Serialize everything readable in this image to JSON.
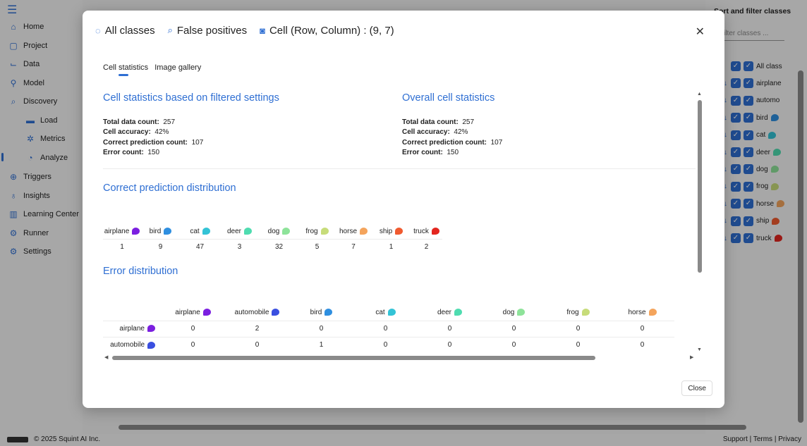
{
  "sidebar": {
    "items": [
      {
        "label": "Home",
        "icon": "home-icon",
        "glyph": "⌂"
      },
      {
        "label": "Project",
        "icon": "project-icon",
        "glyph": "▢"
      },
      {
        "label": "Data",
        "icon": "data-icon",
        "glyph": "⌙"
      },
      {
        "label": "Model",
        "icon": "model-icon",
        "glyph": "⚲"
      },
      {
        "label": "Discovery",
        "icon": "discovery-icon",
        "glyph": "⌕"
      },
      {
        "label": "Load",
        "icon": "folder-icon",
        "glyph": "▬"
      },
      {
        "label": "Metrics",
        "icon": "metrics-icon",
        "glyph": "✲"
      },
      {
        "label": "Analyze",
        "icon": "analyze-icon",
        "glyph": "◔"
      },
      {
        "label": "Triggers",
        "icon": "triggers-icon",
        "glyph": "⊕"
      },
      {
        "label": "Insights",
        "icon": "insights-icon",
        "glyph": "♁"
      },
      {
        "label": "Learning Center",
        "icon": "learning-center-icon",
        "glyph": "▥"
      },
      {
        "label": "Runner",
        "icon": "runner-icon",
        "glyph": "⚙"
      },
      {
        "label": "Settings",
        "icon": "settings-icon",
        "glyph": "⚙"
      }
    ]
  },
  "right_panel": {
    "title": "Sort and filter classes",
    "filter_placeholder": "Filter classes ...",
    "rows": [
      {
        "label": "All class",
        "color": ""
      },
      {
        "label": "airplane",
        "color": ""
      },
      {
        "label": "automo",
        "color": ""
      },
      {
        "label": "bird",
        "color": "#2f8fe0"
      },
      {
        "label": "cat",
        "color": "#33c3d6"
      },
      {
        "label": "deer",
        "color": "#4fdcb0"
      },
      {
        "label": "dog",
        "color": "#8ee39a"
      },
      {
        "label": "frog",
        "color": "#c7dc7a"
      },
      {
        "label": "horse",
        "color": "#f4a45c"
      },
      {
        "label": "ship",
        "color": "#f05a2f"
      },
      {
        "label": "truck",
        "color": "#e3261f"
      }
    ]
  },
  "footer": {
    "copyright": "© 2025 Squint AI Inc.",
    "links": "Support | Terms | Privacy"
  },
  "modal": {
    "header": {
      "all_classes": "All classes",
      "false_positives": "False positives",
      "cell": "Cell (Row, Column) : (9, 7)"
    },
    "tabs": [
      "Cell statistics",
      "Image gallery"
    ],
    "filtered": {
      "title": "Cell statistics based on filtered settings",
      "total_label": "Total data count:",
      "total": "257",
      "accuracy_label": "Cell accuracy:",
      "accuracy": "42%",
      "correct_label": "Correct prediction count:",
      "correct": "107",
      "error_label": "Error count:",
      "error": "150"
    },
    "overall": {
      "title": "Overall cell statistics",
      "total_label": "Total data count:",
      "total": "257",
      "accuracy_label": "Cell accuracy:",
      "accuracy": "42%",
      "correct_label": "Correct prediction count:",
      "correct": "107",
      "error_label": "Error count:",
      "error": "150"
    },
    "correct_dist": {
      "title": "Correct prediction distribution",
      "classes": [
        {
          "name": "airplane",
          "color": "#7b1fe0",
          "value": "1"
        },
        {
          "name": "bird",
          "color": "#2f8fe0",
          "value": "9"
        },
        {
          "name": "cat",
          "color": "#33c3d6",
          "value": "47"
        },
        {
          "name": "deer",
          "color": "#4fdcb0",
          "value": "3"
        },
        {
          "name": "dog",
          "color": "#8ee39a",
          "value": "32"
        },
        {
          "name": "frog",
          "color": "#c7dc7a",
          "value": "5"
        },
        {
          "name": "horse",
          "color": "#f4a45c",
          "value": "7"
        },
        {
          "name": "ship",
          "color": "#f05a2f",
          "value": "1"
        },
        {
          "name": "truck",
          "color": "#e3261f",
          "value": "2"
        }
      ]
    },
    "error_dist": {
      "title": "Error distribution",
      "columns": [
        {
          "name": "airplane",
          "color": "#7b1fe0"
        },
        {
          "name": "automobile",
          "color": "#3a4fe0"
        },
        {
          "name": "bird",
          "color": "#2f8fe0"
        },
        {
          "name": "cat",
          "color": "#33c3d6"
        },
        {
          "name": "deer",
          "color": "#4fdcb0"
        },
        {
          "name": "dog",
          "color": "#8ee39a"
        },
        {
          "name": "frog",
          "color": "#c7dc7a"
        },
        {
          "name": "horse",
          "color": "#f4a45c"
        }
      ],
      "rows": [
        {
          "name": "airplane",
          "color": "#7b1fe0",
          "values": [
            "0",
            "2",
            "0",
            "0",
            "0",
            "0",
            "0",
            "0"
          ]
        },
        {
          "name": "automobile",
          "color": "#3a4fe0",
          "values": [
            "0",
            "0",
            "1",
            "0",
            "0",
            "0",
            "0",
            "0"
          ]
        }
      ]
    },
    "close_label": "Close"
  }
}
